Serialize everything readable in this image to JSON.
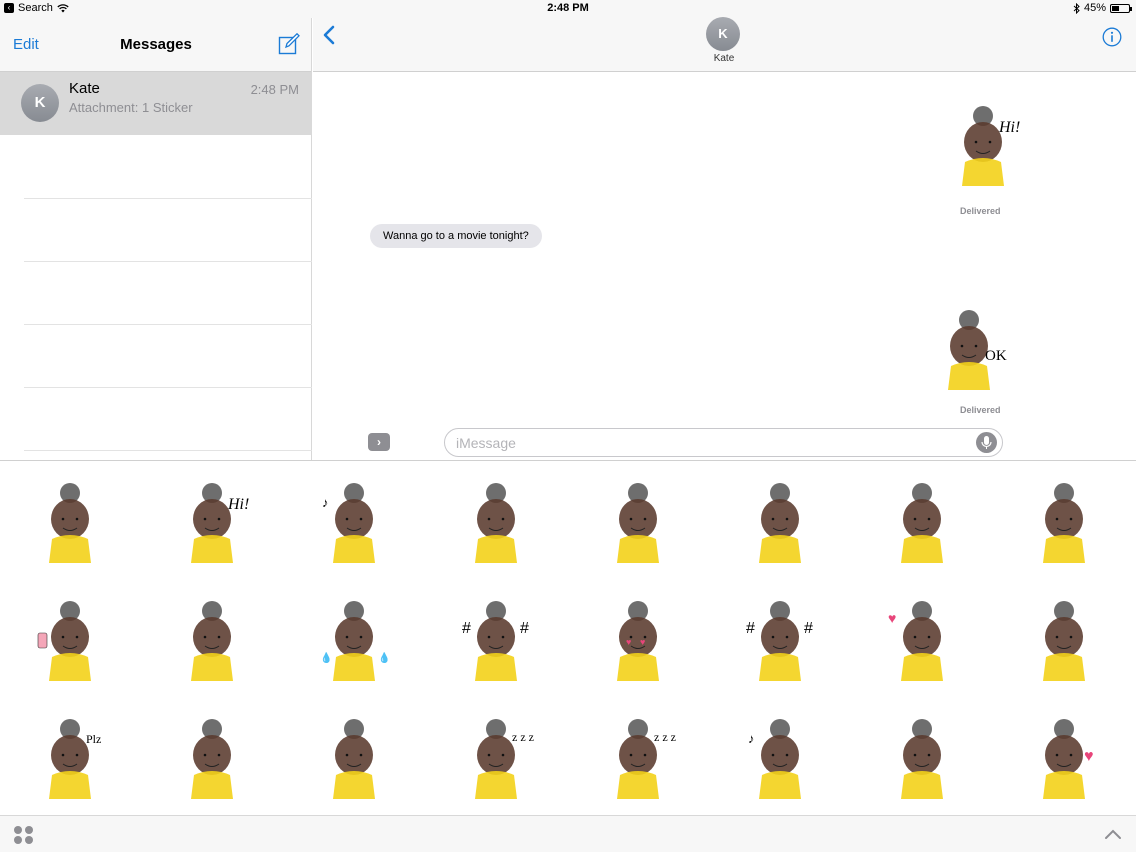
{
  "status_bar": {
    "back_app": "Search",
    "time": "2:48 PM",
    "battery": "45%",
    "battery_level": 0.45
  },
  "conversations": {
    "edit_label": "Edit",
    "title": "Messages",
    "items": [
      {
        "initial": "K",
        "name": "Kate",
        "preview": "Attachment: 1 Sticker",
        "time": "2:48 PM"
      }
    ]
  },
  "chat": {
    "contact_initial": "K",
    "contact_name": "Kate",
    "messages": [
      {
        "type": "sticker",
        "from": "me",
        "sticker": "hi"
      },
      {
        "type": "status",
        "text": "Delivered"
      },
      {
        "type": "text",
        "from": "them",
        "text": "Wanna go to a movie tonight?"
      },
      {
        "type": "sticker",
        "from": "me",
        "sticker": "ok"
      },
      {
        "type": "status",
        "text": "Delivered"
      }
    ],
    "input_placeholder": "iMessage"
  },
  "sticker_drawer": {
    "stickers": [
      "neutral",
      "hi",
      "thinking-music",
      "laugh",
      "shy",
      "tongue",
      "arms-up",
      "phone-angry",
      "selfie",
      "shrug",
      "crying",
      "angry-hash",
      "heart-eyes",
      "pointing-angry",
      "love-pink",
      "point-up",
      "plz",
      "sleepy-sad",
      "hand-chin",
      "steam-sleep",
      "zzz",
      "music",
      "frown",
      "broken-heart"
    ],
    "accent_yellow": "#f3d21a",
    "skin": "#5a3a2e",
    "hair": "#555555"
  },
  "colors": {
    "ios_blue": "#1b7bd6",
    "selected_row": "#d9d9d9"
  }
}
